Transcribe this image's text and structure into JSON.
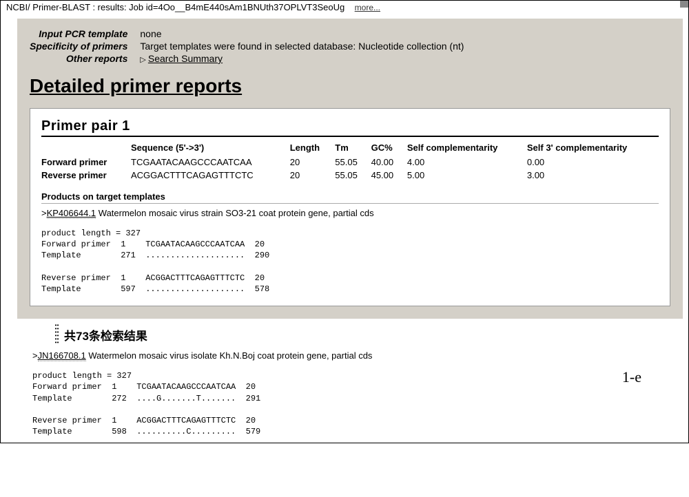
{
  "header": {
    "prefix": "NCBI/ Primer-BLAST : results: Job id=",
    "jobid": "4Oo__B4mE440sAm1BNUth37OPLVT3SeoUg",
    "more": "more..."
  },
  "info": {
    "input_label": "Input PCR template",
    "input_value": "none",
    "spec_label": "Specificity of primers",
    "spec_value": "Target templates were found in selected database: Nucleotide collection (nt)",
    "other_label": "Other reports",
    "other_link": "Search Summary"
  },
  "title": "Detailed primer reports",
  "pair": {
    "title": "Primer pair 1",
    "cols": {
      "seq": "Sequence (5'->3')",
      "len": "Length",
      "tm": "Tm",
      "gc": "GC%",
      "selfc": "Self complementarity",
      "self3": "Self 3' complementarity"
    },
    "fwd": {
      "name": "Forward primer",
      "seq": "TCGAATACAAGCCCAATCAA",
      "len": "20",
      "tm": "55.05",
      "gc": "40.00",
      "selfc": "4.00",
      "self3": "0.00"
    },
    "rev": {
      "name": "Reverse primer",
      "seq": "ACGGACTTTCAGAGTTTCTC",
      "len": "20",
      "tm": "55.05",
      "gc": "45.00",
      "selfc": "5.00",
      "self3": "3.00"
    }
  },
  "products_title": "Products on target templates",
  "hit1": {
    "acc": "KP406644.1",
    "desc": " Watermelon mosaic virus strain SO3-21 coat protein gene, partial cds",
    "align": "product length = 327\nForward primer  1    TCGAATACAAGCCCAATCAA  20\nTemplate        271  ....................  290\n\nReverse primer  1    ACGGACTTTCAGAGTTTCTC  20\nTemplate        597  ....................  578"
  },
  "ellipsis": "共73条检索结果",
  "hit2": {
    "acc": "JN166708.1",
    "desc": " Watermelon mosaic virus isolate Kh.N.Boj coat protein gene, partial cds",
    "align": "product length = 327\nForward primer  1    TCGAATACAAGCCCAATCAA  20\nTemplate        272  ....G.......T.......  291\n\nReverse primer  1    ACGGACTTTCAGAGTTTCTC  20\nTemplate        598  ..........C.........  579"
  },
  "fig": "1-e"
}
